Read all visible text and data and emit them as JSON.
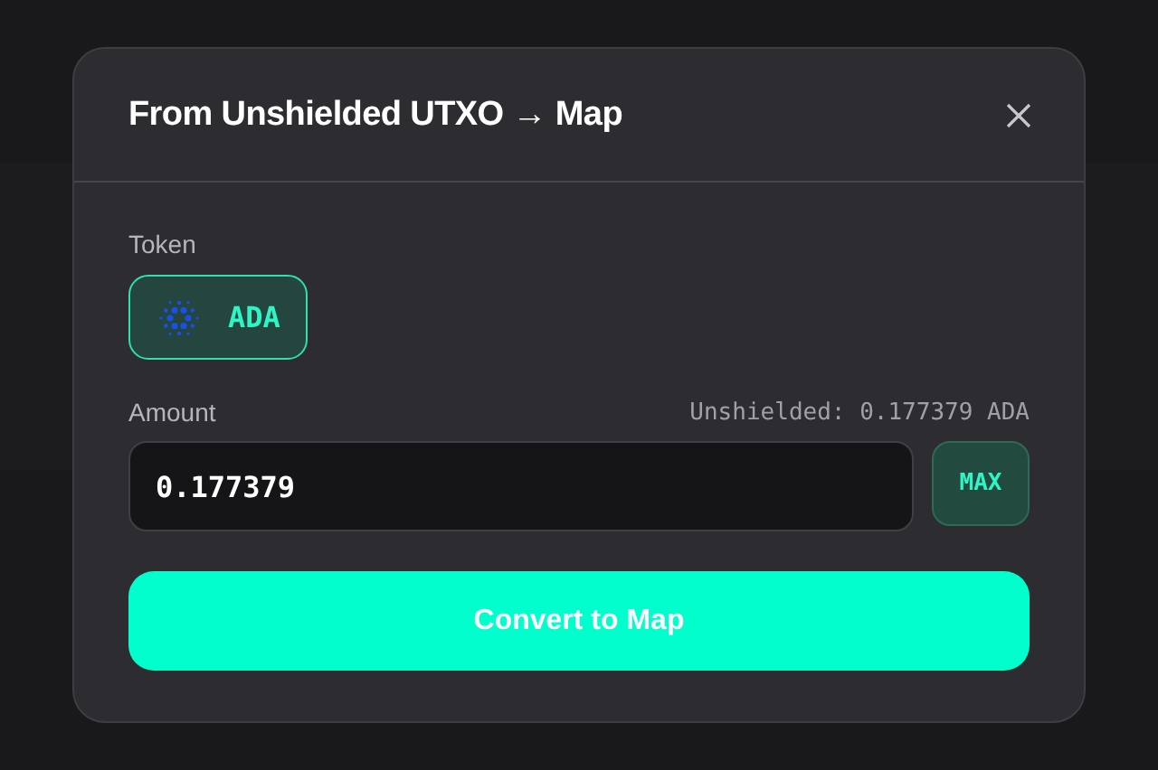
{
  "dialog": {
    "title": "From Unshielded UTXO → Map"
  },
  "token": {
    "label": "Token",
    "options": [
      {
        "symbol": "ADA",
        "selected": true
      }
    ]
  },
  "amount": {
    "label": "Amount",
    "balance": "Unshielded: 0.177379 ADA",
    "value": "0.177379",
    "max_button": "MAX"
  },
  "submit_button": "Convert to Map"
}
